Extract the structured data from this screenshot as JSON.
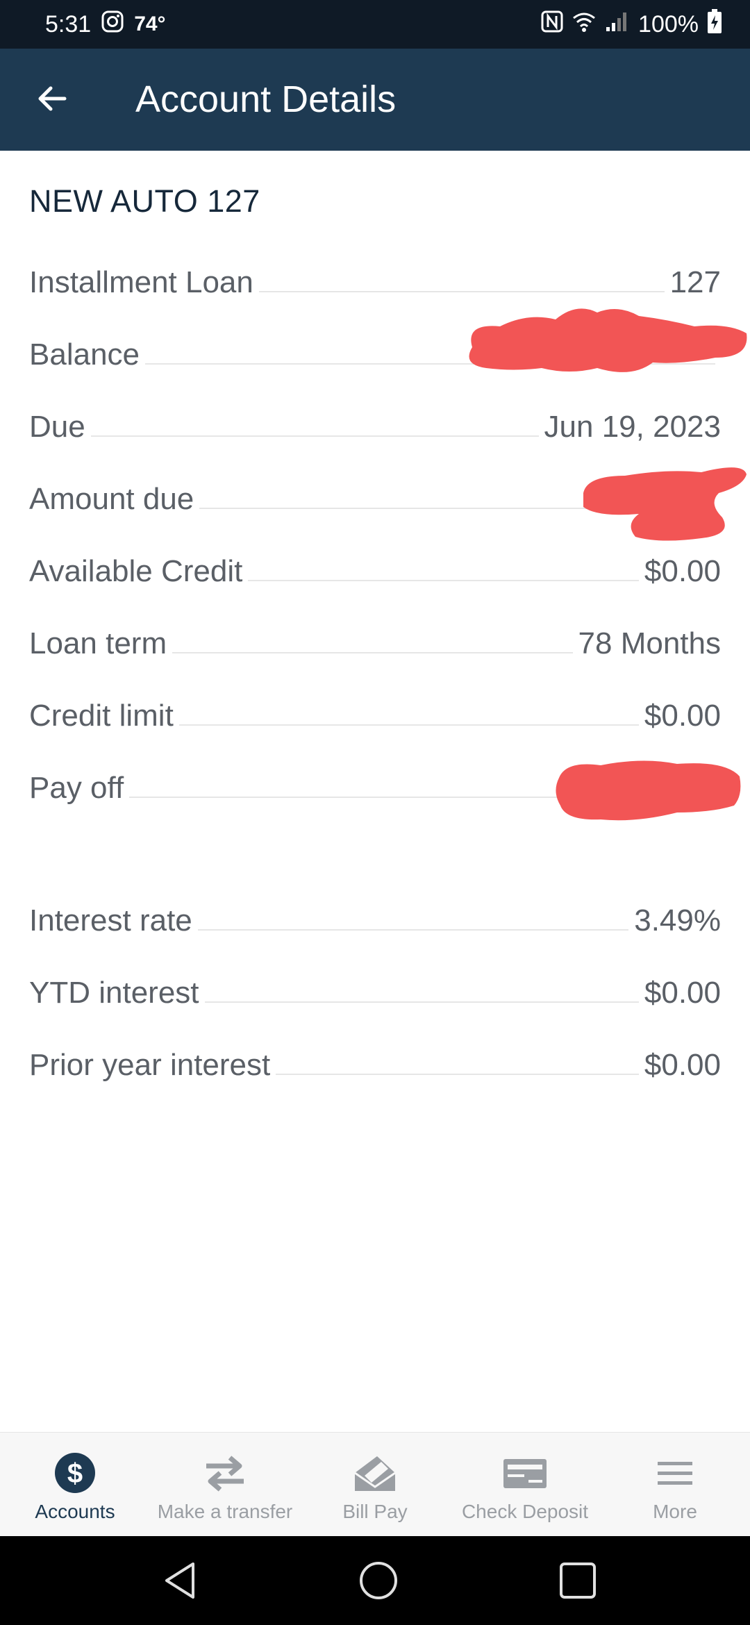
{
  "status_bar": {
    "time": "5:31",
    "temperature": "74°",
    "battery": "100%",
    "icons": [
      "instagram-icon",
      "nfc-icon",
      "wifi-icon",
      "signal-icon",
      "battery-charging-icon"
    ]
  },
  "app_bar": {
    "title": "Account Details",
    "back_icon": "back-arrow-icon"
  },
  "account": {
    "name": "NEW AUTO 127",
    "details": [
      {
        "label": "Installment Loan",
        "value": "127"
      },
      {
        "label": "Balance",
        "value": "",
        "redacted": true
      },
      {
        "label": "Due",
        "value": "Jun 19, 2023"
      },
      {
        "label": "Amount due",
        "value": "",
        "redacted": true
      },
      {
        "label": "Available Credit",
        "value": "$0.00"
      },
      {
        "label": "Loan term",
        "value": "78 Months"
      },
      {
        "label": "Credit limit",
        "value": "$0.00"
      },
      {
        "label": "Pay off",
        "value": "",
        "redacted": true
      }
    ],
    "interest": [
      {
        "label": "Interest rate",
        "value": "3.49%"
      },
      {
        "label": "YTD interest",
        "value": "$0.00"
      },
      {
        "label": "Prior year interest",
        "value": "$0.00"
      }
    ]
  },
  "bottom_nav": {
    "items": [
      {
        "label": "Accounts",
        "icon": "dollar-circle-icon",
        "active": true
      },
      {
        "label": "Make a transfer",
        "icon": "transfer-arrows-icon",
        "active": false
      },
      {
        "label": "Bill Pay",
        "icon": "bill-pay-icon",
        "active": false
      },
      {
        "label": "Check Deposit",
        "icon": "check-icon",
        "active": false
      },
      {
        "label": "More",
        "icon": "menu-icon",
        "active": false
      }
    ]
  },
  "colors": {
    "status_bar": "#0f1a26",
    "app_bar": "#1e3a52",
    "redaction": "#f25555",
    "text_muted": "#5a5f66"
  }
}
